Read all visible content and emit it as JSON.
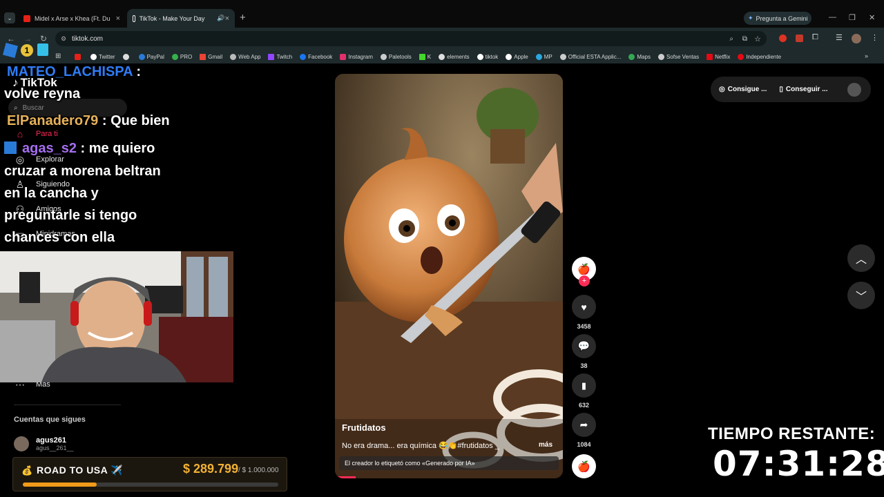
{
  "browser": {
    "tabs": [
      {
        "title": "Midel x Arse x Khea (Ft. Duki x M",
        "favicon_color": "#e62117"
      },
      {
        "title": "TikTok - Make Your Day",
        "favicon_color": "#ffffff"
      }
    ],
    "gemini_label": "Pregunta a Gemini",
    "url": "tiktok.com",
    "bookmarks": [
      {
        "label": "Twitter",
        "color": "#ffffff"
      },
      {
        "label": "PayPal",
        "color": "#2a7bd8"
      },
      {
        "label": "PRO",
        "color": "#35b14a"
      },
      {
        "label": "Gmail",
        "color": "#ea4335"
      },
      {
        "label": "Web App",
        "color": "#bbbbbb"
      },
      {
        "label": "Twitch",
        "color": "#9146ff"
      },
      {
        "label": "Facebook",
        "color": "#1877f2"
      },
      {
        "label": "Instagram",
        "color": "#e1306c"
      },
      {
        "label": "Paletools",
        "color": "#cccccc"
      },
      {
        "label": "K",
        "color": "#44d62c"
      },
      {
        "label": "elements",
        "color": "#dddddd"
      },
      {
        "label": "tiktok",
        "color": "#ffffff"
      },
      {
        "label": "Apple",
        "color": "#ffffff"
      },
      {
        "label": "MP",
        "color": "#2aa7e0"
      },
      {
        "label": "Official ESTA Applic...",
        "color": "#cccccc"
      },
      {
        "label": "Maps",
        "color": "#34a853"
      },
      {
        "label": "Sofse Ventas",
        "color": "#cccccc"
      },
      {
        "label": "Netflix",
        "color": "#e50914"
      },
      {
        "label": "Independiente",
        "color": "#e50914"
      }
    ]
  },
  "tiktok": {
    "logo": "TikTok",
    "search_placeholder": "Buscar",
    "nav": {
      "for_you": "Para ti",
      "explore": "Explorar",
      "following": "Siguiendo",
      "friends": "Amigos",
      "minidramas": "Minidramas",
      "more": "Más"
    },
    "following_title": "Cuentas que sigues",
    "following_user": {
      "name": "agus261",
      "handle": "agus__261__"
    },
    "top_right": {
      "btn1": "Consigue ...",
      "btn2": "Conseguir ..."
    },
    "video": {
      "author": "Frutidatos",
      "caption": "No era drama... era química 😂👏#frutidatos _",
      "more": "más",
      "ai_label": "El creador lo etiquetó como «Generado por IA»"
    },
    "actions": {
      "likes": "3458",
      "comments": "38",
      "saves": "632",
      "shares": "1084"
    }
  },
  "stream": {
    "chat": [
      {
        "user": "MATEO_LACHISPA",
        "sep": " :",
        "lines": [
          "volve reyna"
        ]
      },
      {
        "user": "ElPanadero79",
        "sep": " : Que bien",
        "lines": []
      },
      {
        "user": "agas_s2",
        "sep": " : me quiero",
        "lines": [
          "cruzar a morena beltran",
          "en la cancha y",
          "preguntarle si tengo",
          "chances con ella"
        ]
      }
    ],
    "timer_title": "TIEMPO RESTANTE:",
    "timer": "07:31:28",
    "goal": {
      "label": "ROAD TO USA ✈️",
      "current": "$ 289.799",
      "target": "/ $ 1.000.000",
      "progress": 0.29
    }
  }
}
